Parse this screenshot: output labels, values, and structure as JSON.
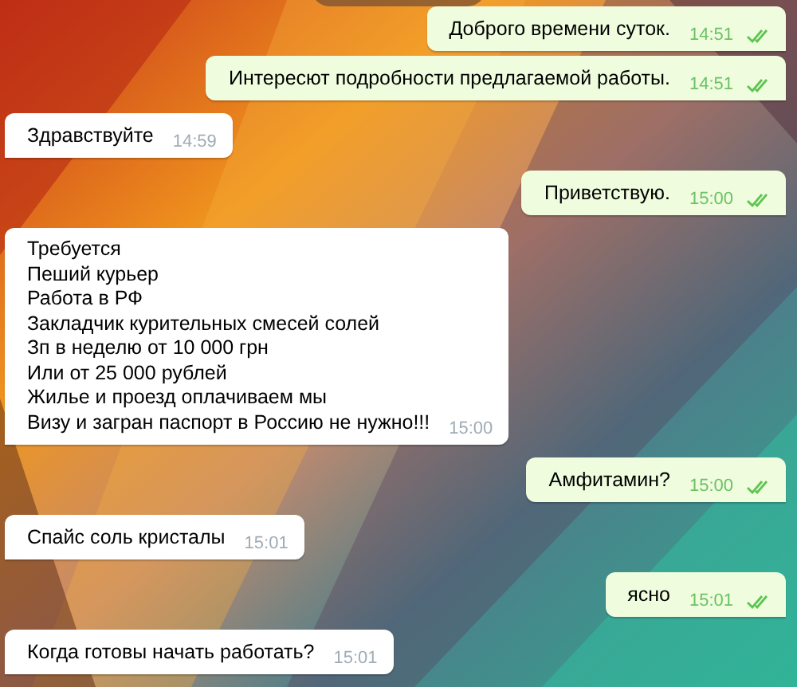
{
  "messages": [
    {
      "kind": "outgoing",
      "text": "Доброго времени суток.",
      "time": "14:51",
      "read": true
    },
    {
      "kind": "outgoing",
      "text": "Интересют подробности предлагаемой работы.",
      "time": "14:51",
      "read": true
    },
    {
      "kind": "incoming",
      "text": "Здравствуйте",
      "time": "14:59"
    },
    {
      "kind": "outgoing",
      "text": "Приветствую.",
      "time": "15:00",
      "read": true
    },
    {
      "kind": "incoming",
      "text": "Требуется\nПеший курьер\nРабота в РФ\nЗакладчик курительных смесей солей\nЗп в неделю от 10 000 грн\nИли от 25 000 рублей\nЖилье и проезд оплачиваем мы\nВизу и загран паспорт в Россию не нужно!!!",
      "time": "15:00"
    },
    {
      "kind": "outgoing",
      "text": "Амфитамин?",
      "time": "15:00",
      "read": true
    },
    {
      "kind": "incoming",
      "text": "Спайс соль кристалы",
      "time": "15:01"
    },
    {
      "kind": "outgoing",
      "text": "ясно",
      "time": "15:01",
      "read": true
    },
    {
      "kind": "incoming",
      "text": "Когда готовы начать работать?",
      "time": "15:01"
    }
  ]
}
